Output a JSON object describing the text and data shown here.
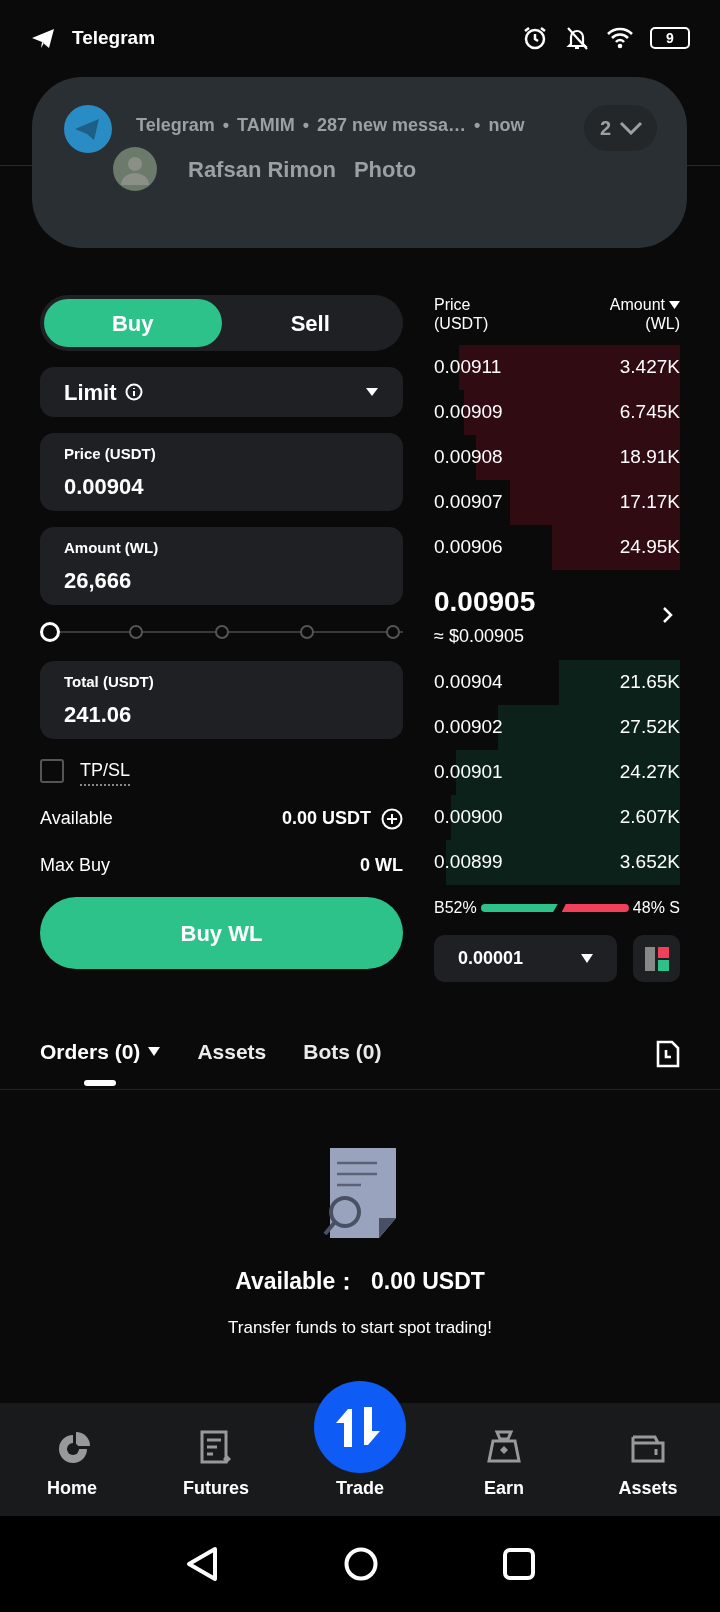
{
  "status_bar": {
    "app": "Telegram",
    "battery": "9"
  },
  "notification": {
    "app": "Telegram",
    "separator": "•",
    "sender": "TAMIM",
    "summary": "287 new messa…",
    "time": "now",
    "count": "2",
    "title": "Rafsan Rimon",
    "text": "Photo"
  },
  "order_form": {
    "sides": [
      {
        "label": "Buy",
        "selected": true
      },
      {
        "label": "Sell",
        "selected": false
      }
    ],
    "order_type": "Limit",
    "price_field": {
      "label": "Price (USDT)",
      "value": "0.00904"
    },
    "amount_field": {
      "label": "Amount (WL)",
      "value": "26,666"
    },
    "slider": {
      "level": 0
    },
    "total_field": {
      "label": "Total (USDT)",
      "value": "241.06"
    },
    "tpsl": {
      "label": "TP/SL",
      "checked": false
    },
    "info": [
      {
        "label": "Available",
        "value": "0.00 USDT",
        "kind": "balance"
      },
      {
        "label": "Max Buy",
        "value": "0 WL",
        "kind": "plain"
      }
    ],
    "submit": "Buy WL"
  },
  "order_book": {
    "columns": [
      {
        "label": "Price",
        "unit": "(USDT)"
      },
      {
        "label": "Amount",
        "unit": "(WL)"
      }
    ],
    "asks": [
      {
        "price": "0.00911",
        "amount": "3.427K"
      },
      {
        "price": "0.00909",
        "amount": "6.745K"
      },
      {
        "price": "0.00908",
        "amount": "18.91K"
      },
      {
        "price": "0.00907",
        "amount": "17.17K"
      },
      {
        "price": "0.00906",
        "amount": "24.95K"
      }
    ],
    "last_price": "0.00905",
    "last_price_usd": "≈ $0.00905",
    "bids": [
      {
        "price": "0.00904",
        "amount": "21.65K"
      },
      {
        "price": "0.00902",
        "amount": "27.52K"
      },
      {
        "price": "0.00901",
        "amount": "24.27K"
      },
      {
        "price": "0.00900",
        "amount": "2.607K"
      },
      {
        "price": "0.00899",
        "amount": "3.652K"
      }
    ],
    "ratio": {
      "buy_label": "B52%",
      "sell_label": "48% S"
    },
    "tick_size": "0.00001"
  },
  "orders_tabs": [
    {
      "label": "Orders (0)",
      "selected": true,
      "menu": true
    },
    {
      "label": "Assets",
      "selected": false,
      "menu": false
    },
    {
      "label": "Bots (0)",
      "selected": false,
      "menu": false
    }
  ],
  "empty_state": {
    "available": "Available：  0.00 USDT",
    "message": "Transfer funds to start spot trading!"
  },
  "bottom_nav": [
    {
      "label": "Home",
      "kind": "home"
    },
    {
      "label": "Futures",
      "kind": "futures"
    },
    {
      "label": "Trade",
      "kind": "trade"
    },
    {
      "label": "Earn",
      "kind": "earn"
    },
    {
      "label": "Assets",
      "kind": "assets"
    }
  ]
}
